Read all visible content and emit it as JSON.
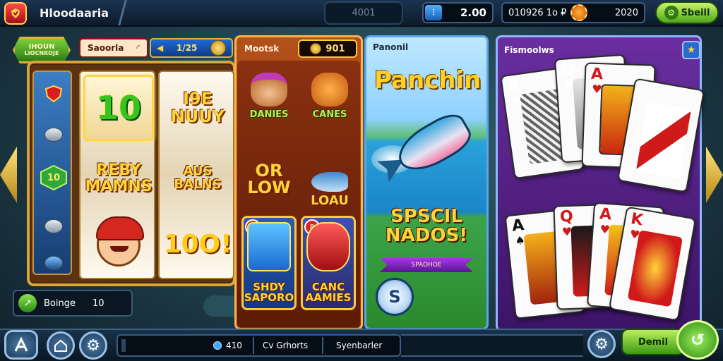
{
  "header": {
    "app_title": "Hloodaaria",
    "center_value": "4001",
    "coin_balance": "2.00",
    "status_text": "010926 1o ₽",
    "status_value": "2020",
    "action_button": "Sbeill"
  },
  "slot": {
    "badge_line1": "IHOUN",
    "badge_line2": "LIOCNROJE",
    "label": "Saoorla",
    "label_value": "1/25",
    "rail": [
      "10"
    ],
    "reel1": [
      "10",
      "REBY MAMNS",
      ""
    ],
    "reel2": [
      "I9E NUUY",
      "AUS BALNS",
      "10O!"
    ]
  },
  "games": {
    "header_label": "Mootsk",
    "header_value": "901",
    "tiles": [
      "DANIES",
      "CANES",
      "OR LOW",
      "LOAU"
    ],
    "cards": [
      {
        "tag": "8",
        "text": "SHDY SAPORO"
      },
      {
        "tag": "8",
        "text": "CANC AAMIES"
      }
    ]
  },
  "fishing": {
    "tag": "Panonil",
    "title": "Panchin",
    "special": "SPSCIL NADOS!",
    "ribbon": "SPAOHOE",
    "round_button": "S"
  },
  "cards_panel": {
    "tag": "Fismoolws",
    "star_icon": "★",
    "top_cards": [
      {
        "rank": "R",
        "suit": "♠",
        "color": "black"
      },
      {
        "rank": "Q",
        "suit": "♠",
        "color": "black"
      },
      {
        "rank": "A",
        "suit": "♥",
        "color": "red"
      },
      {
        "rank": "",
        "suit": "",
        "color": "red"
      }
    ],
    "bottom_cards": [
      {
        "rank": "A",
        "suit": "♠",
        "color": "black"
      },
      {
        "rank": "Q",
        "suit": "♥",
        "color": "red"
      },
      {
        "rank": "A",
        "suit": "♥",
        "color": "red"
      },
      {
        "rank": "K",
        "suit": "♥",
        "color": "red"
      }
    ]
  },
  "bottom_left": {
    "label": "Boinge",
    "value": "10"
  },
  "bottombar": {
    "strip_value": "410",
    "strip_label1": "Cv Grhorts",
    "strip_label2": "Syenbarler",
    "demo_button": "Demil"
  },
  "colors": {
    "accent_green": "#4ea81a",
    "panel_purple": "#6a2ea0",
    "panel_orange": "#b4501a",
    "gold": "#ffd43a"
  }
}
